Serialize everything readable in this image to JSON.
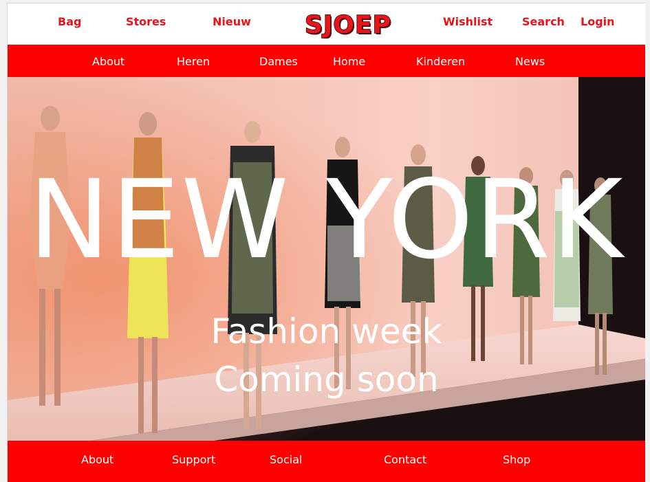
{
  "header": {
    "links": {
      "bag": "Bag",
      "stores": "Stores",
      "nieuw": "Nieuw",
      "wishlist": "Wishlist",
      "search": "Search",
      "login": "Login"
    },
    "logo_text": "SJOEP"
  },
  "main_nav": {
    "about": "About",
    "heren": "Heren",
    "dames": "Dames",
    "home": "Home",
    "kinderen": "Kinderen",
    "news": "News"
  },
  "hero": {
    "title": "NEW YORK",
    "subtitle_line1": "Fashion week",
    "subtitle_line2": "Coming soon"
  },
  "footer": {
    "about": "About",
    "support": "Support",
    "social": "Social",
    "contact": "Contact",
    "shop": "Shop"
  },
  "colors": {
    "brand_red": "#ff0000",
    "link_red": "#e8141b",
    "white": "#ffffff"
  }
}
